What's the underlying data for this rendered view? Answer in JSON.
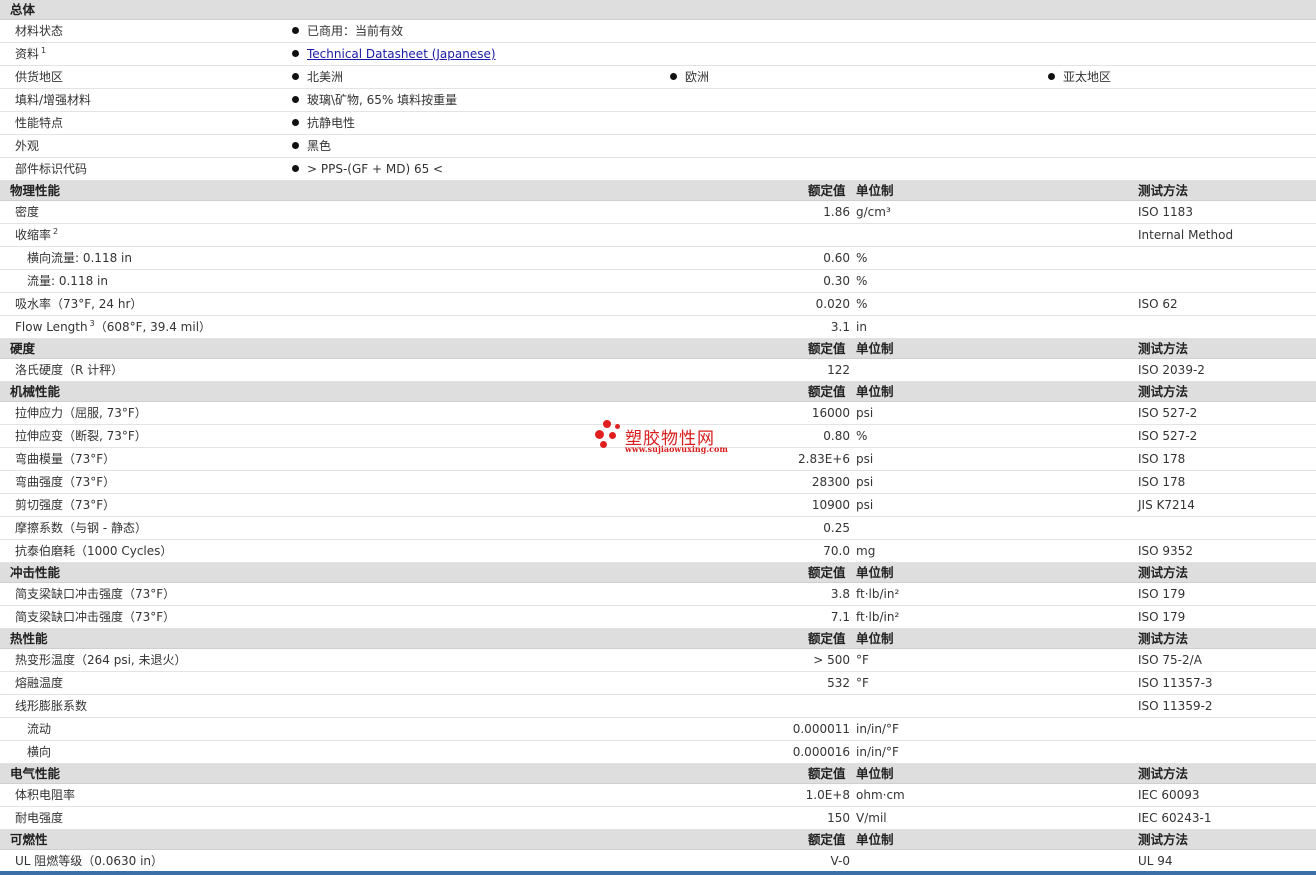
{
  "general": {
    "title": "总体",
    "rows": [
      {
        "label": "材料状态",
        "items": [
          "已商用：当前有效"
        ]
      },
      {
        "label": "资料",
        "sup": "1",
        "items": [
          "Technical Datasheet (Japanese)"
        ],
        "link": true
      },
      {
        "label": "供货地区",
        "items": [
          "北美洲",
          "欧洲",
          "亚太地区"
        ]
      },
      {
        "label": "填料/增强材料",
        "items": [
          "玻璃\\矿物, 65% 填料按重量"
        ]
      },
      {
        "label": "性能特点",
        "items": [
          "抗静电性"
        ]
      },
      {
        "label": "外观",
        "items": [
          "黑色"
        ]
      },
      {
        "label": "部件标识代码",
        "items": [
          "> PPS-(GF + MD) 65 <"
        ]
      }
    ]
  },
  "headers": {
    "value": "额定值",
    "unit": "单位制",
    "method": "测试方法"
  },
  "sections": [
    {
      "title": "物理性能",
      "rows": [
        {
          "label": "密度",
          "value": "1.86",
          "unit": "g/cm³",
          "method": "ISO 1183"
        },
        {
          "label": "收缩率",
          "sup": "2",
          "value": "",
          "unit": "",
          "method": "Internal Method"
        },
        {
          "label": "横向流量: 0.118 in",
          "sub": true,
          "value": "0.60",
          "unit": "%",
          "method": ""
        },
        {
          "label": "流量: 0.118 in",
          "sub": true,
          "value": "0.30",
          "unit": "%",
          "method": ""
        },
        {
          "label": "吸水率（73°F, 24 hr）",
          "value": "0.020",
          "unit": "%",
          "method": "ISO 62"
        },
        {
          "label": "Flow Length",
          "sup": "3",
          "label_suffix": "（608°F, 39.4 mil）",
          "value": "3.1",
          "unit": "in",
          "method": ""
        }
      ]
    },
    {
      "title": "硬度",
      "rows": [
        {
          "label": "洛氏硬度（R 计秤）",
          "value": "122",
          "unit": "",
          "method": "ISO 2039-2"
        }
      ]
    },
    {
      "title": "机械性能",
      "rows": [
        {
          "label": "拉伸应力（屈服, 73°F）",
          "value": "16000",
          "unit": "psi",
          "method": "ISO 527-2"
        },
        {
          "label": "拉伸应变（断裂, 73°F）",
          "value": "0.80",
          "unit": "%",
          "method": "ISO 527-2"
        },
        {
          "label": "弯曲模量（73°F）",
          "value": "2.83E+6",
          "unit": "psi",
          "method": "ISO 178"
        },
        {
          "label": "弯曲强度（73°F）",
          "value": "28300",
          "unit": "psi",
          "method": "ISO 178"
        },
        {
          "label": "剪切强度（73°F）",
          "value": "10900",
          "unit": "psi",
          "method": "JIS K7214"
        },
        {
          "label": "摩擦系数（与钢 - 静态）",
          "value": "0.25",
          "unit": "",
          "method": ""
        },
        {
          "label": "抗泰伯磨耗（1000 Cycles）",
          "value": "70.0",
          "unit": "mg",
          "method": "ISO 9352"
        }
      ]
    },
    {
      "title": "冲击性能",
      "rows": [
        {
          "label": "简支梁缺口冲击强度（73°F）",
          "value": "3.8",
          "unit": "ft·lb/in²",
          "method": "ISO 179"
        },
        {
          "label": "简支梁缺口冲击强度（73°F）",
          "value": "7.1",
          "unit": "ft·lb/in²",
          "method": "ISO 179"
        }
      ]
    },
    {
      "title": "热性能",
      "rows": [
        {
          "label": "热变形温度（264 psi, 未退火）",
          "value": "> 500",
          "unit": "°F",
          "method": "ISO 75-2/A"
        },
        {
          "label": "熔融温度",
          "value": "532",
          "unit": "°F",
          "method": "ISO 11357-3"
        },
        {
          "label": "线形膨胀系数",
          "value": "",
          "unit": "",
          "method": "ISO 11359-2"
        },
        {
          "label": "流动",
          "sub": true,
          "value": "0.000011",
          "unit": "in/in/°F",
          "method": ""
        },
        {
          "label": "横向",
          "sub": true,
          "value": "0.000016",
          "unit": "in/in/°F",
          "method": ""
        }
      ]
    },
    {
      "title": "电气性能",
      "rows": [
        {
          "label": "体积电阻率",
          "value": "1.0E+8",
          "unit": "ohm·cm",
          "method": "IEC 60093"
        },
        {
          "label": "耐电强度",
          "value": "150",
          "unit": "V/mil",
          "method": "IEC 60243-1"
        }
      ]
    },
    {
      "title": "可燃性",
      "rows": [
        {
          "label": "UL 阻燃等级（0.0630 in）",
          "value": "V-0",
          "unit": "",
          "method": "UL 94"
        }
      ]
    }
  ],
  "watermark": {
    "title": "塑胶物性网",
    "url": "www.sujiaowuxing.com"
  },
  "colors": {
    "section_bg": "#dedede",
    "link": "#1a1aa6",
    "watermark": "#d81e1e",
    "bottom_bar": "#3c6ea8"
  }
}
